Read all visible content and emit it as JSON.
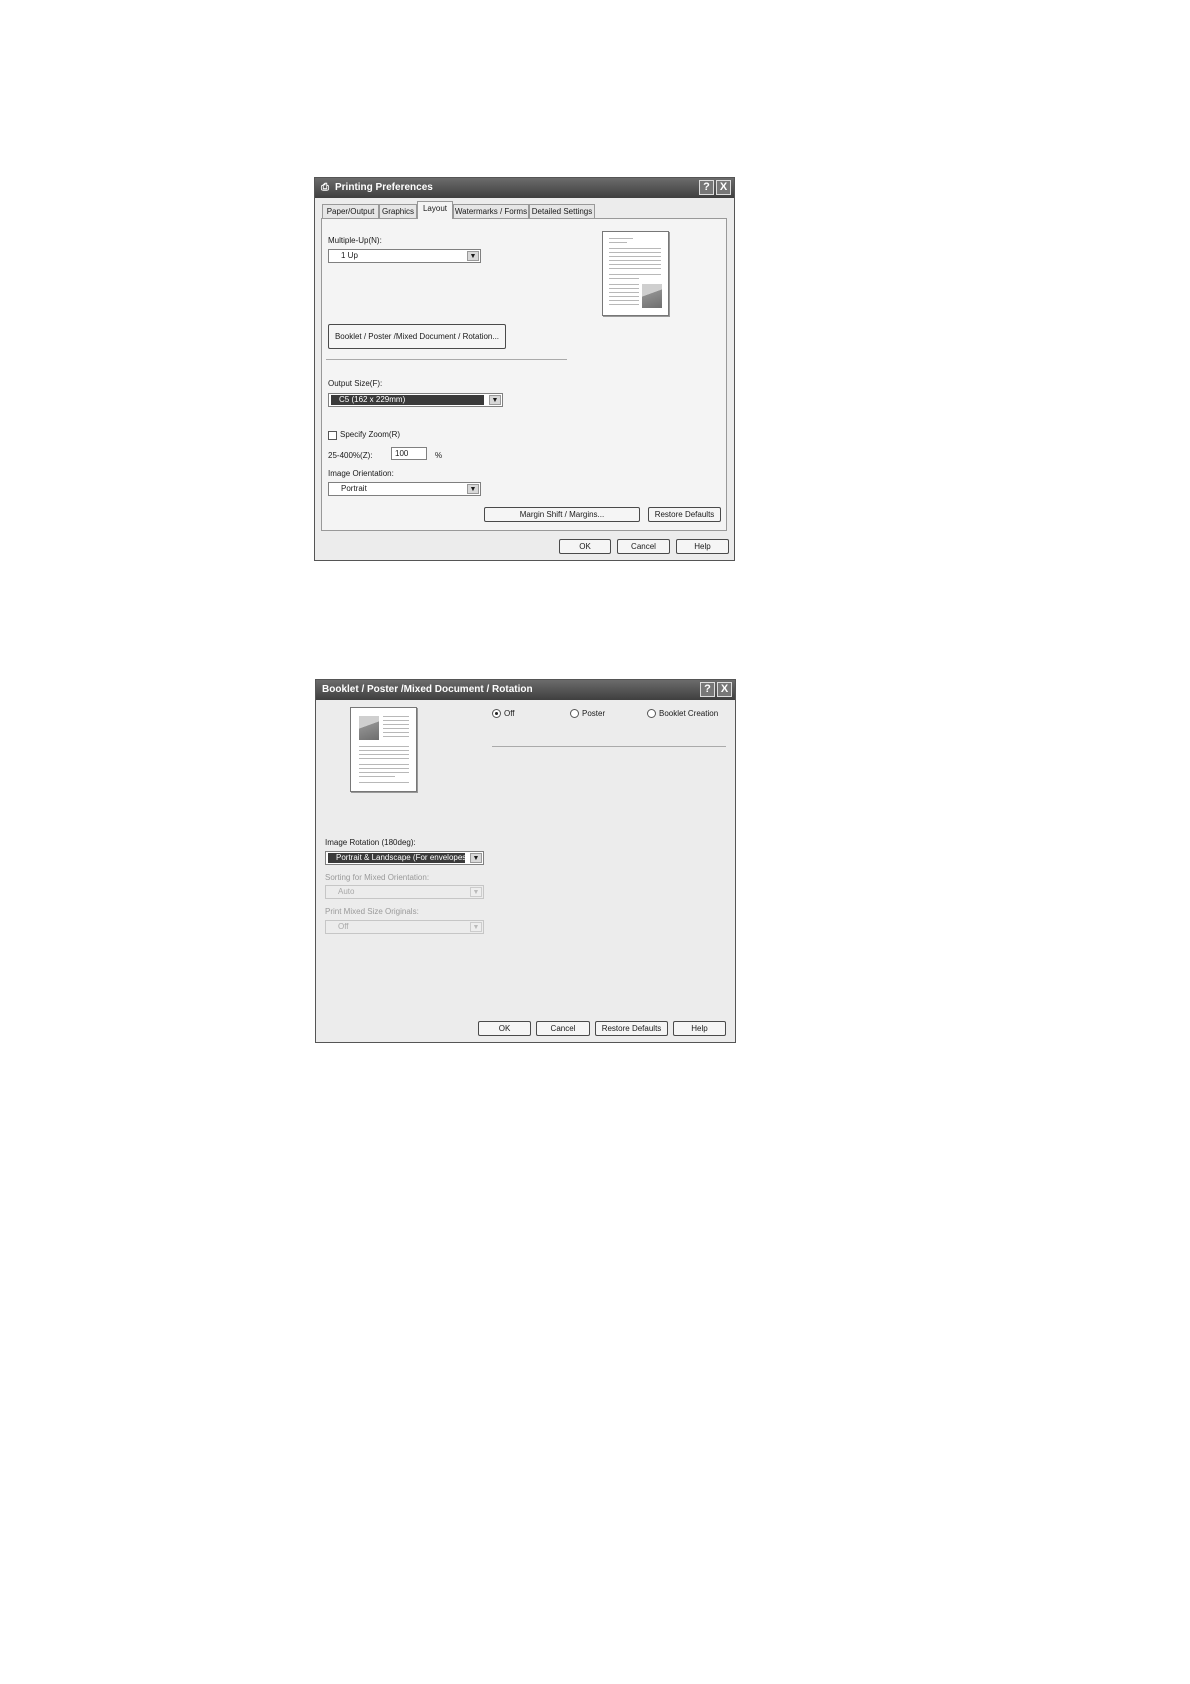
{
  "dialog1": {
    "title": "Printing Preferences",
    "tabs": [
      "Paper/Output",
      "Graphics",
      "Layout",
      "Watermarks / Forms",
      "Detailed Settings"
    ],
    "active_tab": "Layout",
    "multiple_up_label": "Multiple-Up(N):",
    "multiple_up_value": "1 Up",
    "booklet_button": "Booklet / Poster /Mixed Document / Rotation...",
    "output_size_label": "Output Size(F):",
    "output_size_value": "C5 (162 x 229mm)",
    "specify_zoom_label": "Specify Zoom(R)",
    "zoom_range_label": "25-400%(Z):",
    "zoom_value": "100",
    "zoom_unit": "%",
    "orientation_label": "Image Orientation:",
    "orientation_value": "Portrait",
    "margin_button": "Margin Shift / Margins...",
    "restore_button": "Restore Defaults",
    "ok": "OK",
    "cancel": "Cancel",
    "help": "Help"
  },
  "dialog2": {
    "title": "Booklet / Poster /Mixed Document / Rotation",
    "radio_off": "Off",
    "radio_poster": "Poster",
    "radio_booklet": "Booklet Creation",
    "selected_radio": "Off",
    "image_rotation_label": "Image Rotation (180deg):",
    "image_rotation_value": "Portrait & Landscape (For envelopes)",
    "sorting_label": "Sorting for Mixed Orientation:",
    "sorting_value": "Auto",
    "print_mixed_label": "Print Mixed Size Originals:",
    "print_mixed_value": "Off",
    "ok": "OK",
    "cancel": "Cancel",
    "restore": "Restore Defaults",
    "help": "Help"
  },
  "icons": {
    "help": "?",
    "close": "X",
    "dropdown": "▼",
    "printer": "printer-icon"
  }
}
